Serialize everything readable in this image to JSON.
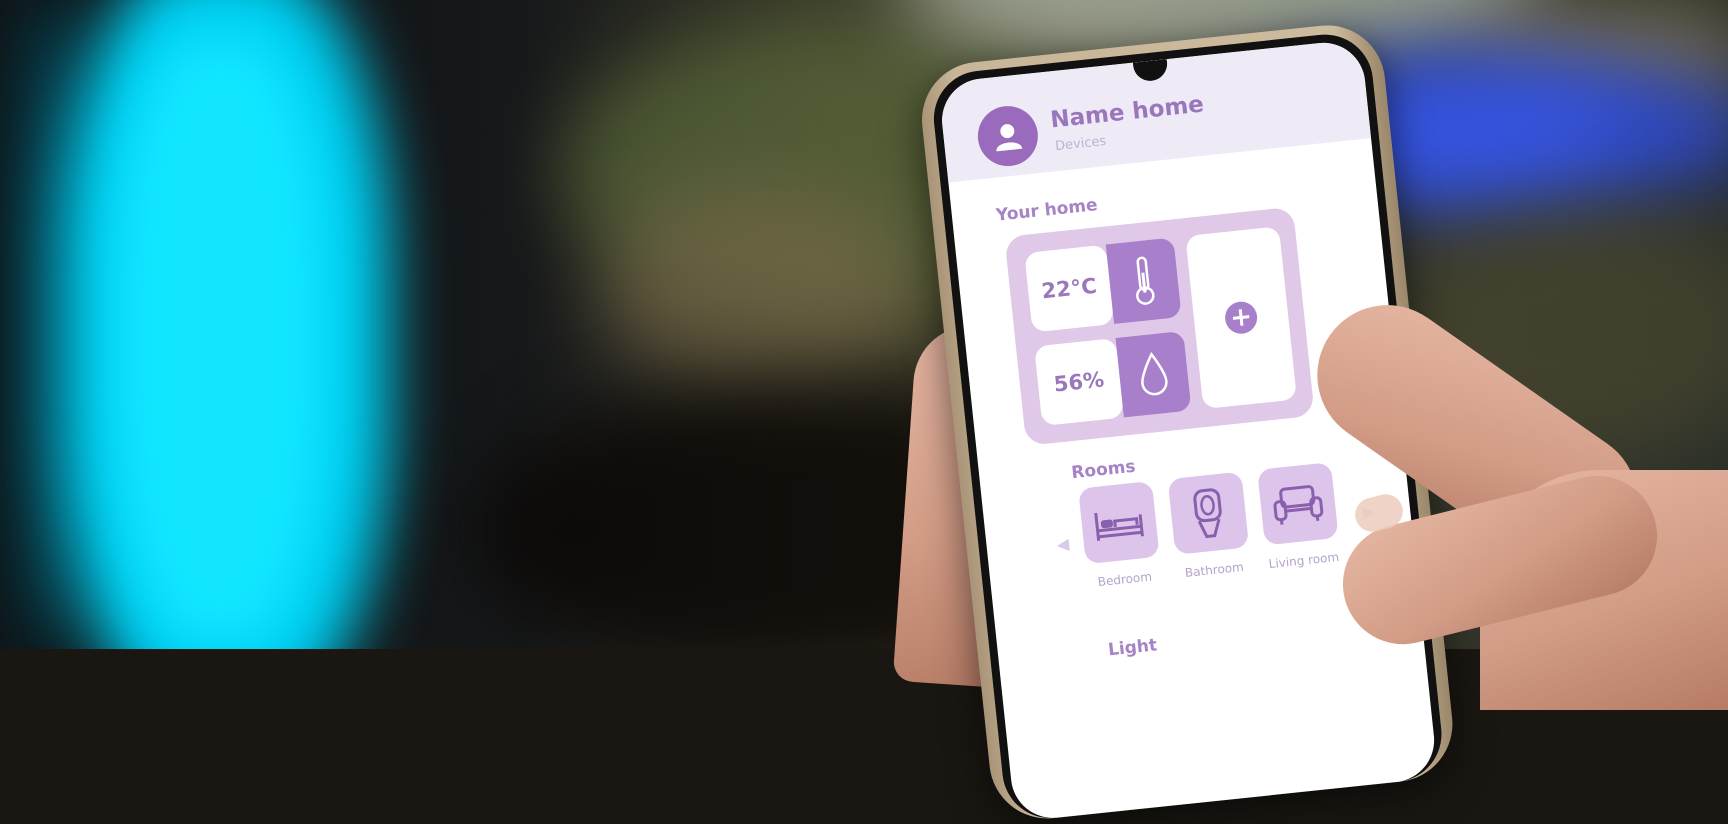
{
  "header": {
    "title": "Name home",
    "subtitle": "Devices"
  },
  "home": {
    "section_label": "Your home",
    "temperature": "22°C",
    "humidity": "56%",
    "add_symbol": "+"
  },
  "rooms": {
    "section_label": "Rooms",
    "items": [
      {
        "label": "Bedroom",
        "icon": "bed-icon"
      },
      {
        "label": "Bathroom",
        "icon": "toilet-icon"
      },
      {
        "label": "Living room",
        "icon": "sofa-icon"
      }
    ],
    "prev_arrow": "◀",
    "next_arrow": "▶"
  },
  "light": {
    "section_label": "Light"
  },
  "colors": {
    "accent": "#a77fcb",
    "accent_light": "#dfc8e8",
    "header_bg": "#eeebf6",
    "text": "#9a77bd"
  }
}
